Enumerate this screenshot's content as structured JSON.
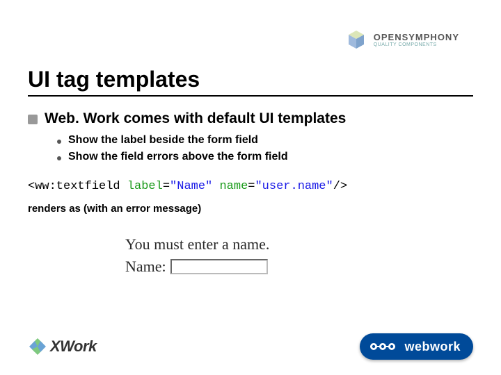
{
  "header": {
    "brand_main": "OPENSYMPHONY",
    "brand_sub": "QUALITY COMPONENTS"
  },
  "title": "UI tag templates",
  "bullets": {
    "main": "Web. Work comes with default UI templates",
    "subs": [
      "Show the label beside the form field",
      "Show the field errors above the form field"
    ]
  },
  "code": {
    "open": "<ww:textfield",
    "attr1": " label",
    "eq1": "=",
    "val1": "\"Name\"",
    "attr2": " name",
    "eq2": "=",
    "val2": "\"user.name\"",
    "close": "/>"
  },
  "note": "renders as (with an error message)",
  "example": {
    "error": "You must enter a name.",
    "label": "Name:"
  },
  "footer": {
    "left": "XWork",
    "right": "webwork"
  }
}
